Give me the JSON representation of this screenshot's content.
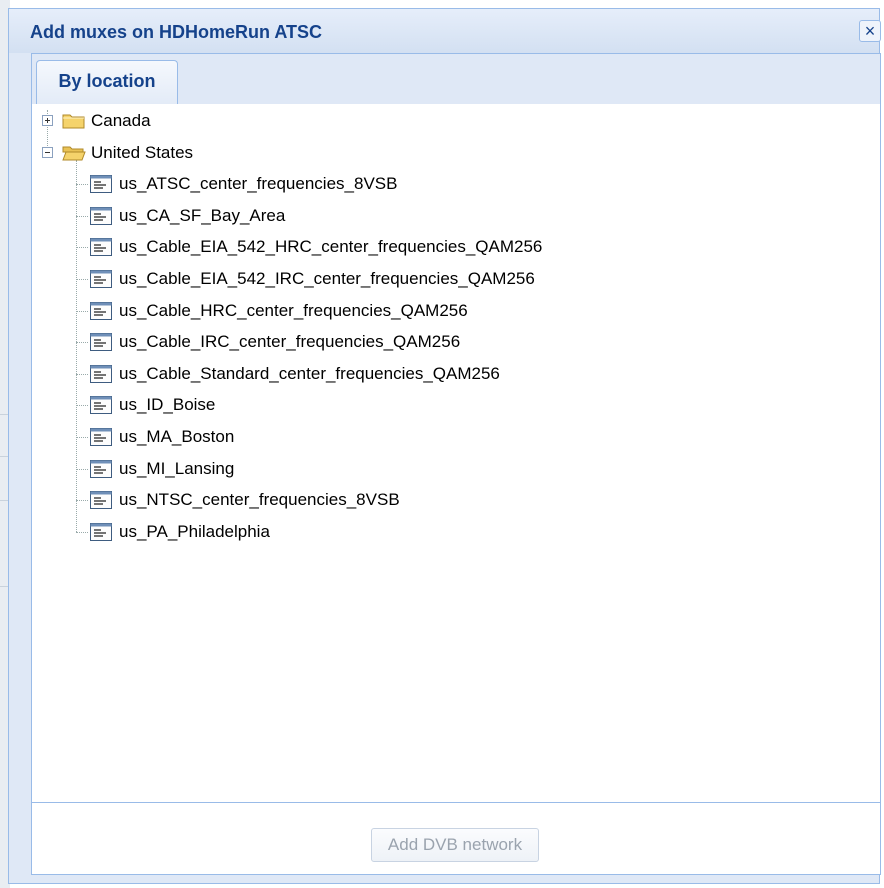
{
  "window": {
    "title": "Add muxes on HDHomeRun ATSC",
    "close_glyph": "×"
  },
  "tabs": [
    {
      "label": "By location",
      "active": true
    }
  ],
  "tree": {
    "folders": [
      {
        "label": "Canada",
        "expanded": false,
        "icon": "folder-closed-icon"
      },
      {
        "label": "United States",
        "expanded": true,
        "icon": "folder-open-icon"
      }
    ],
    "items": [
      "us_ATSC_center_frequencies_8VSB",
      "us_CA_SF_Bay_Area",
      "us_Cable_EIA_542_HRC_center_frequencies_QAM256",
      "us_Cable_EIA_542_IRC_center_frequencies_QAM256",
      "us_Cable_HRC_center_frequencies_QAM256",
      "us_Cable_IRC_center_frequencies_QAM256",
      "us_Cable_Standard_center_frequencies_QAM256",
      "us_ID_Boise",
      "us_MA_Boston",
      "us_MI_Lansing",
      "us_NTSC_center_frequencies_8VSB",
      "us_PA_Philadelphia"
    ]
  },
  "footer": {
    "add_button_label": "Add DVB network",
    "add_button_enabled": false
  },
  "colors": {
    "title": "#15428b",
    "border": "#99bbe8",
    "frame": "#dfe8f6",
    "folder": "#f5d36b"
  }
}
